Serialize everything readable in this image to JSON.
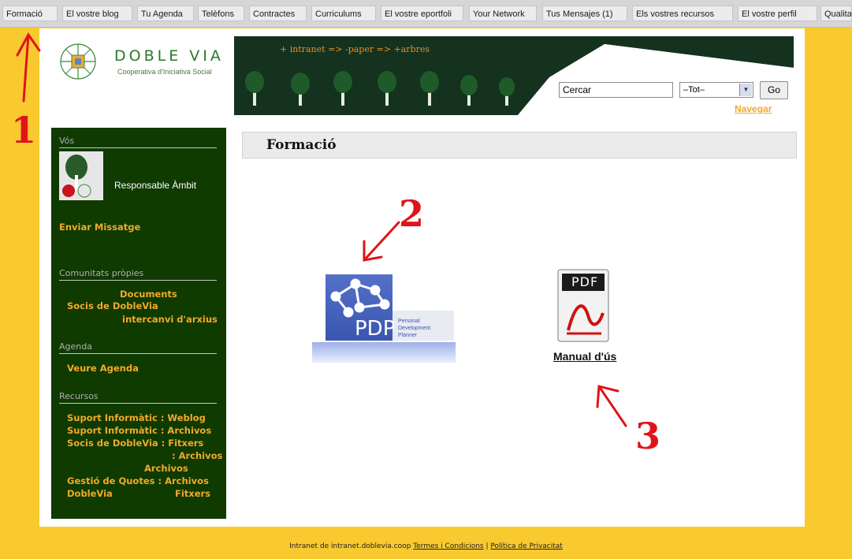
{
  "tabs": [
    "Formació",
    "El vostre blog",
    "Tu Agenda",
    "Telèfons",
    "Contractes",
    "Curriculums",
    "El vostre eportfoli",
    "Your Network",
    "Tus Mensajes (1)",
    "Els vostres recursos",
    "El vostre perfil",
    "Qualitat"
  ],
  "logo": {
    "brand": "DOBLE VIA",
    "tagline": "Cooperativa d'Iniciativa Social"
  },
  "banner": {
    "breadcrumb": "+ intranet => -paper => +arbres"
  },
  "search": {
    "value": "Cercar",
    "scope": "–Tot–",
    "go_label": "Go",
    "browse_label": "Navegar"
  },
  "sidebar": {
    "you_heading": "Vós",
    "role": "Responsable Àmbit",
    "send_message": "Enviar Missatge",
    "communities_heading": "Comunitats pròpies",
    "communities": [
      "Documents",
      "Socis de DobleVia",
      "intercanvi d'arxius"
    ],
    "agenda_heading": "Agenda",
    "agenda_link": "Veure Agenda",
    "resources_heading": "Recursos",
    "resources": [
      "Suport Informàtic : Weblog",
      "Suport Informàtic : Archivos",
      "Socis de DobleVia : Fitxers",
      ": Archivos",
      "Archivos",
      "Gestió de Quotes : Archivos",
      "DobleVia",
      "Fitxers"
    ]
  },
  "content": {
    "title": "Formació",
    "pdp": {
      "abbr": "PDP",
      "line1": "Personal",
      "line2": "Development",
      "line3": "Planner"
    },
    "pdf": {
      "badge": "PDF",
      "label": "Manual d'ús"
    }
  },
  "footer": {
    "text": "Intranet de intranet.doblevia.coop",
    "terms": "Termes i Condicions",
    "sep": "|",
    "privacy": "Política de Privacitat"
  },
  "annotations": [
    "1",
    "2",
    "3"
  ],
  "colors": {
    "accent": "#f9c930",
    "sidebar": "#0f3a00",
    "link": "#f2a92a",
    "annotation": "#e0141a"
  }
}
